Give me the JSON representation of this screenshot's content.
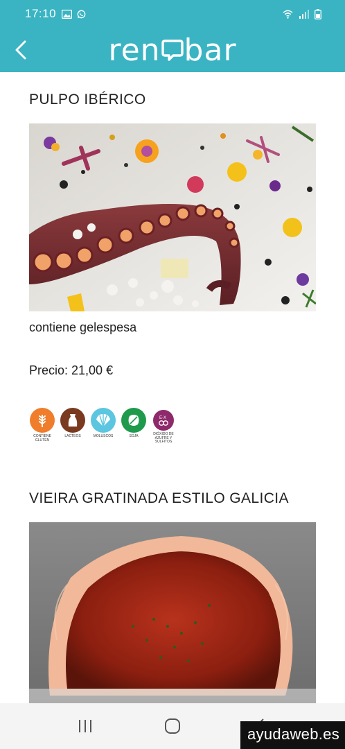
{
  "status_bar": {
    "time": "17:10",
    "left_icons": [
      "gallery-icon",
      "whatsapp-icon"
    ],
    "right_icons": [
      "wifi-icon",
      "signal-icon",
      "battery-icon"
    ]
  },
  "app_bar": {
    "logo_prefix": "ren",
    "logo_suffix": "bar",
    "color": "#3ab4c2"
  },
  "dishes": [
    {
      "title": "PULPO IBÉRICO",
      "description": "contiene gelespesa",
      "price": "Precio: 21,00 €",
      "allergens": [
        {
          "icon": "gluten-icon",
          "label": "CONTIENE GLUTEN",
          "color": "#ef7d2b"
        },
        {
          "icon": "lacteos-icon",
          "label": "LACTEOS",
          "color": "#7a3a1f"
        },
        {
          "icon": "moluscos-icon",
          "label": "MOLUSCOS",
          "color": "#5cc6e0"
        },
        {
          "icon": "soja-icon",
          "label": "SOJA",
          "color": "#1f9a4c"
        },
        {
          "icon": "sulfitos-icon",
          "label": "DIÓXIDO DE AZUFRE Y SULFITOS",
          "color": "#8e2a6b"
        }
      ]
    },
    {
      "title": "VIEIRA GRATINADA ESTILO GALICIA"
    }
  ],
  "watermark": "ayudaweb.es"
}
